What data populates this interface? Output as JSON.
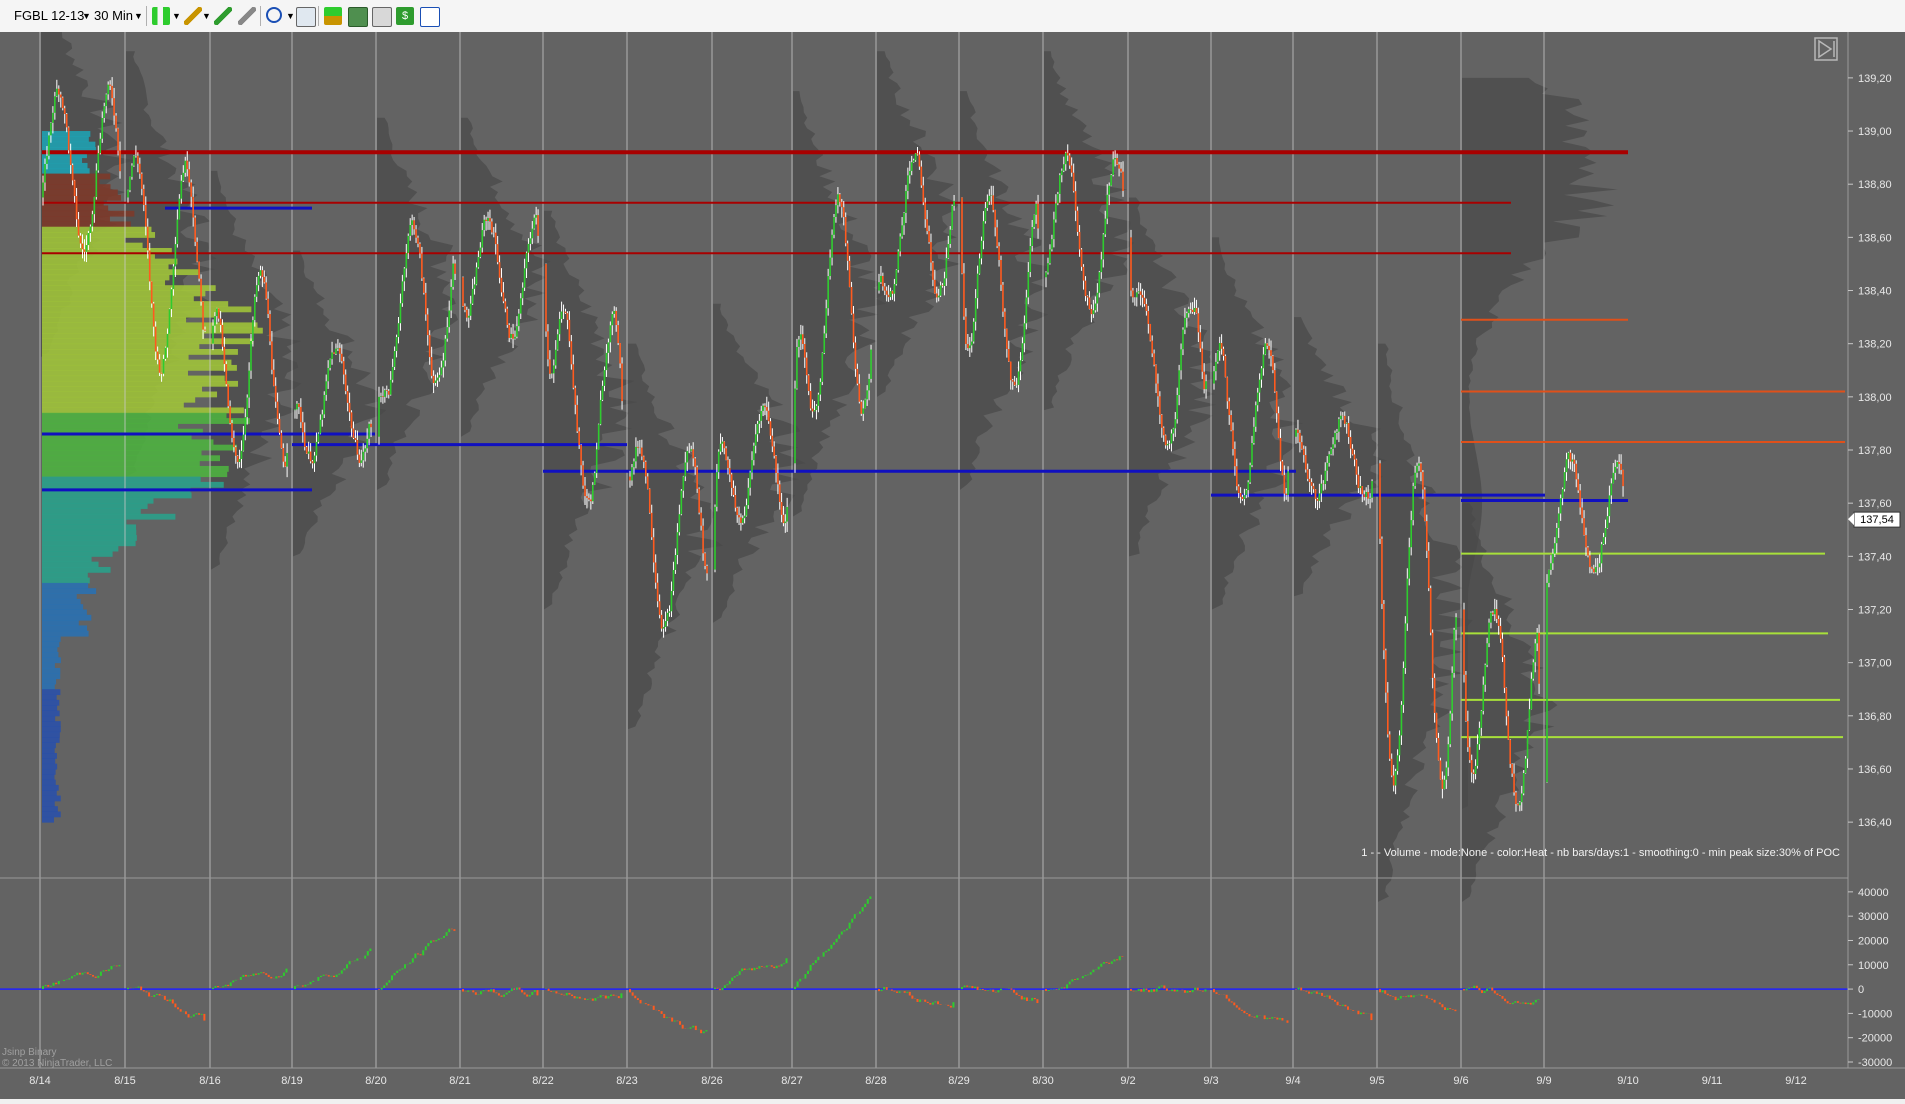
{
  "toolbar": {
    "instrument": "FGBL 12-13",
    "interval": "30 Min"
  },
  "chart_data": {
    "type": "bar",
    "price_axis": {
      "ticks": [
        "139,20",
        "139,00",
        "138,80",
        "138,60",
        "138,40",
        "138,20",
        "138,00",
        "137,80",
        "137,60",
        "137,40",
        "137,20",
        "137,00",
        "136,80",
        "136,60",
        "136,40"
      ],
      "range": [
        136.25,
        139.35
      ]
    },
    "indicator_axis": {
      "ticks": [
        "40000",
        "30000",
        "20000",
        "10000",
        "0",
        "-10000",
        "-20000",
        "-30000"
      ],
      "range": [
        -30000,
        42000
      ]
    },
    "dates": [
      "8/14",
      "8/15",
      "8/16",
      "8/19",
      "8/20",
      "8/21",
      "8/22",
      "8/23",
      "8/26",
      "8/27",
      "8/28",
      "8/29",
      "8/30",
      "9/2",
      "9/3",
      "9/4",
      "9/5",
      "9/6",
      "9/9",
      "9/10",
      "9/11",
      "9/12"
    ],
    "last_price": "137,54",
    "indicator_caption": "1 -  - Volume - mode:None - color:Heat - nb bars/days:1 - smoothing:0 - min peak size:30% of POC",
    "copyright": "© 2013 NinjaTrader, LLC",
    "watermark": "Jsinp Binary",
    "daily_closes": [
      138.75,
      138.2,
      137.95,
      137.85,
      138.45,
      138.5,
      137.7,
      137.35,
      137.75,
      138.4,
      138.75,
      138.45,
      138.6,
      138.05,
      137.85,
      137.75,
      137.2,
      136.55,
      137.54
    ],
    "daily_highs": [
      139.2,
      138.95,
      138.5,
      138.2,
      138.7,
      138.7,
      138.35,
      137.85,
      138.0,
      138.8,
      138.95,
      138.8,
      138.95,
      138.4,
      138.25,
      137.95,
      137.85,
      137.25,
      137.8
    ],
    "daily_lows": [
      138.5,
      138.05,
      137.7,
      137.75,
      138.0,
      138.2,
      137.55,
      137.1,
      137.5,
      137.9,
      138.35,
      138.0,
      138.3,
      137.75,
      137.55,
      137.6,
      136.45,
      136.45,
      137.3
    ],
    "cumulative_delta": [
      10000,
      -12000,
      8000,
      16000,
      25000,
      -2000,
      -3000,
      -18000,
      12000,
      39000,
      -6000,
      -5000,
      14000,
      0,
      -14000,
      -12000,
      -8000,
      -5000
    ],
    "horizontal_levels": [
      {
        "price": 138.92,
        "kind": "poc-major",
        "color": "#a80000"
      },
      {
        "price": 138.73,
        "kind": "poc",
        "color": "#a80000"
      },
      {
        "price": 138.54,
        "kind": "poc",
        "color": "#a80000"
      },
      {
        "price": 138.71,
        "kind": "va-high",
        "color": "#1010c0"
      },
      {
        "price": 137.86,
        "kind": "va-low",
        "color": "#1010c0"
      },
      {
        "price": 137.82,
        "kind": "va-low",
        "color": "#1010c0"
      },
      {
        "price": 137.72,
        "kind": "va-low",
        "color": "#1010c0"
      },
      {
        "price": 137.65,
        "kind": "va-low",
        "color": "#1010c0"
      },
      {
        "price": 137.63,
        "kind": "va-low",
        "color": "#1010c0"
      },
      {
        "price": 137.61,
        "kind": "va-low",
        "color": "#1010c0"
      },
      {
        "price": 138.29,
        "kind": "resistance",
        "color": "#e0501a"
      },
      {
        "price": 138.02,
        "kind": "resistance",
        "color": "#e0501a"
      },
      {
        "price": 137.83,
        "kind": "resistance",
        "color": "#e0501a"
      },
      {
        "price": 137.41,
        "kind": "support",
        "color": "#a8e03a"
      },
      {
        "price": 137.11,
        "kind": "support",
        "color": "#a8e03a"
      },
      {
        "price": 136.86,
        "kind": "support",
        "color": "#a8e03a"
      },
      {
        "price": 136.72,
        "kind": "support",
        "color": "#a8e03a"
      }
    ]
  },
  "colors": {
    "background": "#636363",
    "grid": "#c8c8c8",
    "up_bar": "#2ecc2e",
    "down_bar": "#ff5a1e",
    "profile": "#4a4a4a",
    "zero_line": "#2020ff"
  }
}
